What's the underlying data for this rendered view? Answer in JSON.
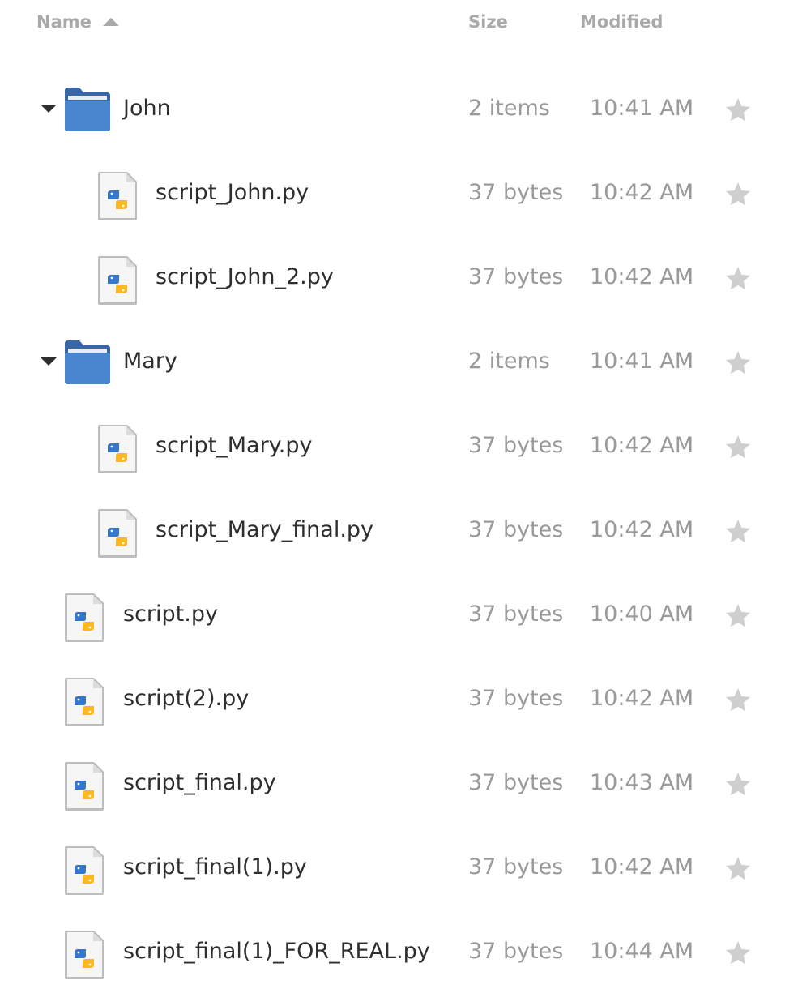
{
  "header": {
    "name_label": "Name",
    "size_label": "Size",
    "modified_label": "Modified",
    "sort_icon": "sort-ascending-icon"
  },
  "colors": {
    "folder": "#4a86cf",
    "folder_dark": "#3767a6",
    "python_blue": "#3776c9",
    "python_yellow": "#f9b923",
    "star": "#cfcfcf",
    "text": "#2e2e2e",
    "muted": "#9a9a9a"
  },
  "rows": [
    {
      "type": "folder",
      "level": 0,
      "expanded": true,
      "name": "John",
      "size": "2 items",
      "modified": "10:41 AM",
      "icon": "folder-icon"
    },
    {
      "type": "file",
      "level": 1,
      "name": "script_John.py",
      "size": "37 bytes",
      "modified": "10:42 AM",
      "icon": "python-file-icon"
    },
    {
      "type": "file",
      "level": 1,
      "name": "script_John_2.py",
      "size": "37 bytes",
      "modified": "10:42 AM",
      "icon": "python-file-icon"
    },
    {
      "type": "folder",
      "level": 0,
      "expanded": true,
      "name": "Mary",
      "size": "2 items",
      "modified": "10:41 AM",
      "icon": "folder-icon"
    },
    {
      "type": "file",
      "level": 1,
      "name": "script_Mary.py",
      "size": "37 bytes",
      "modified": "10:42 AM",
      "icon": "python-file-icon"
    },
    {
      "type": "file",
      "level": 1,
      "name": "script_Mary_final.py",
      "size": "37 bytes",
      "modified": "10:42 AM",
      "icon": "python-file-icon"
    },
    {
      "type": "file",
      "level": 0,
      "name": "script.py",
      "size": "37 bytes",
      "modified": "10:40 AM",
      "icon": "python-file-icon"
    },
    {
      "type": "file",
      "level": 0,
      "name": "script(2).py",
      "size": "37 bytes",
      "modified": "10:42 AM",
      "icon": "python-file-icon"
    },
    {
      "type": "file",
      "level": 0,
      "name": "script_final.py",
      "size": "37 bytes",
      "modified": "10:43 AM",
      "icon": "python-file-icon"
    },
    {
      "type": "file",
      "level": 0,
      "name": "script_final(1).py",
      "size": "37 bytes",
      "modified": "10:42 AM",
      "icon": "python-file-icon"
    },
    {
      "type": "file",
      "level": 0,
      "name": "script_final(1)_FOR_REAL.py",
      "size": "37 bytes",
      "modified": "10:44 AM",
      "icon": "python-file-icon"
    }
  ]
}
